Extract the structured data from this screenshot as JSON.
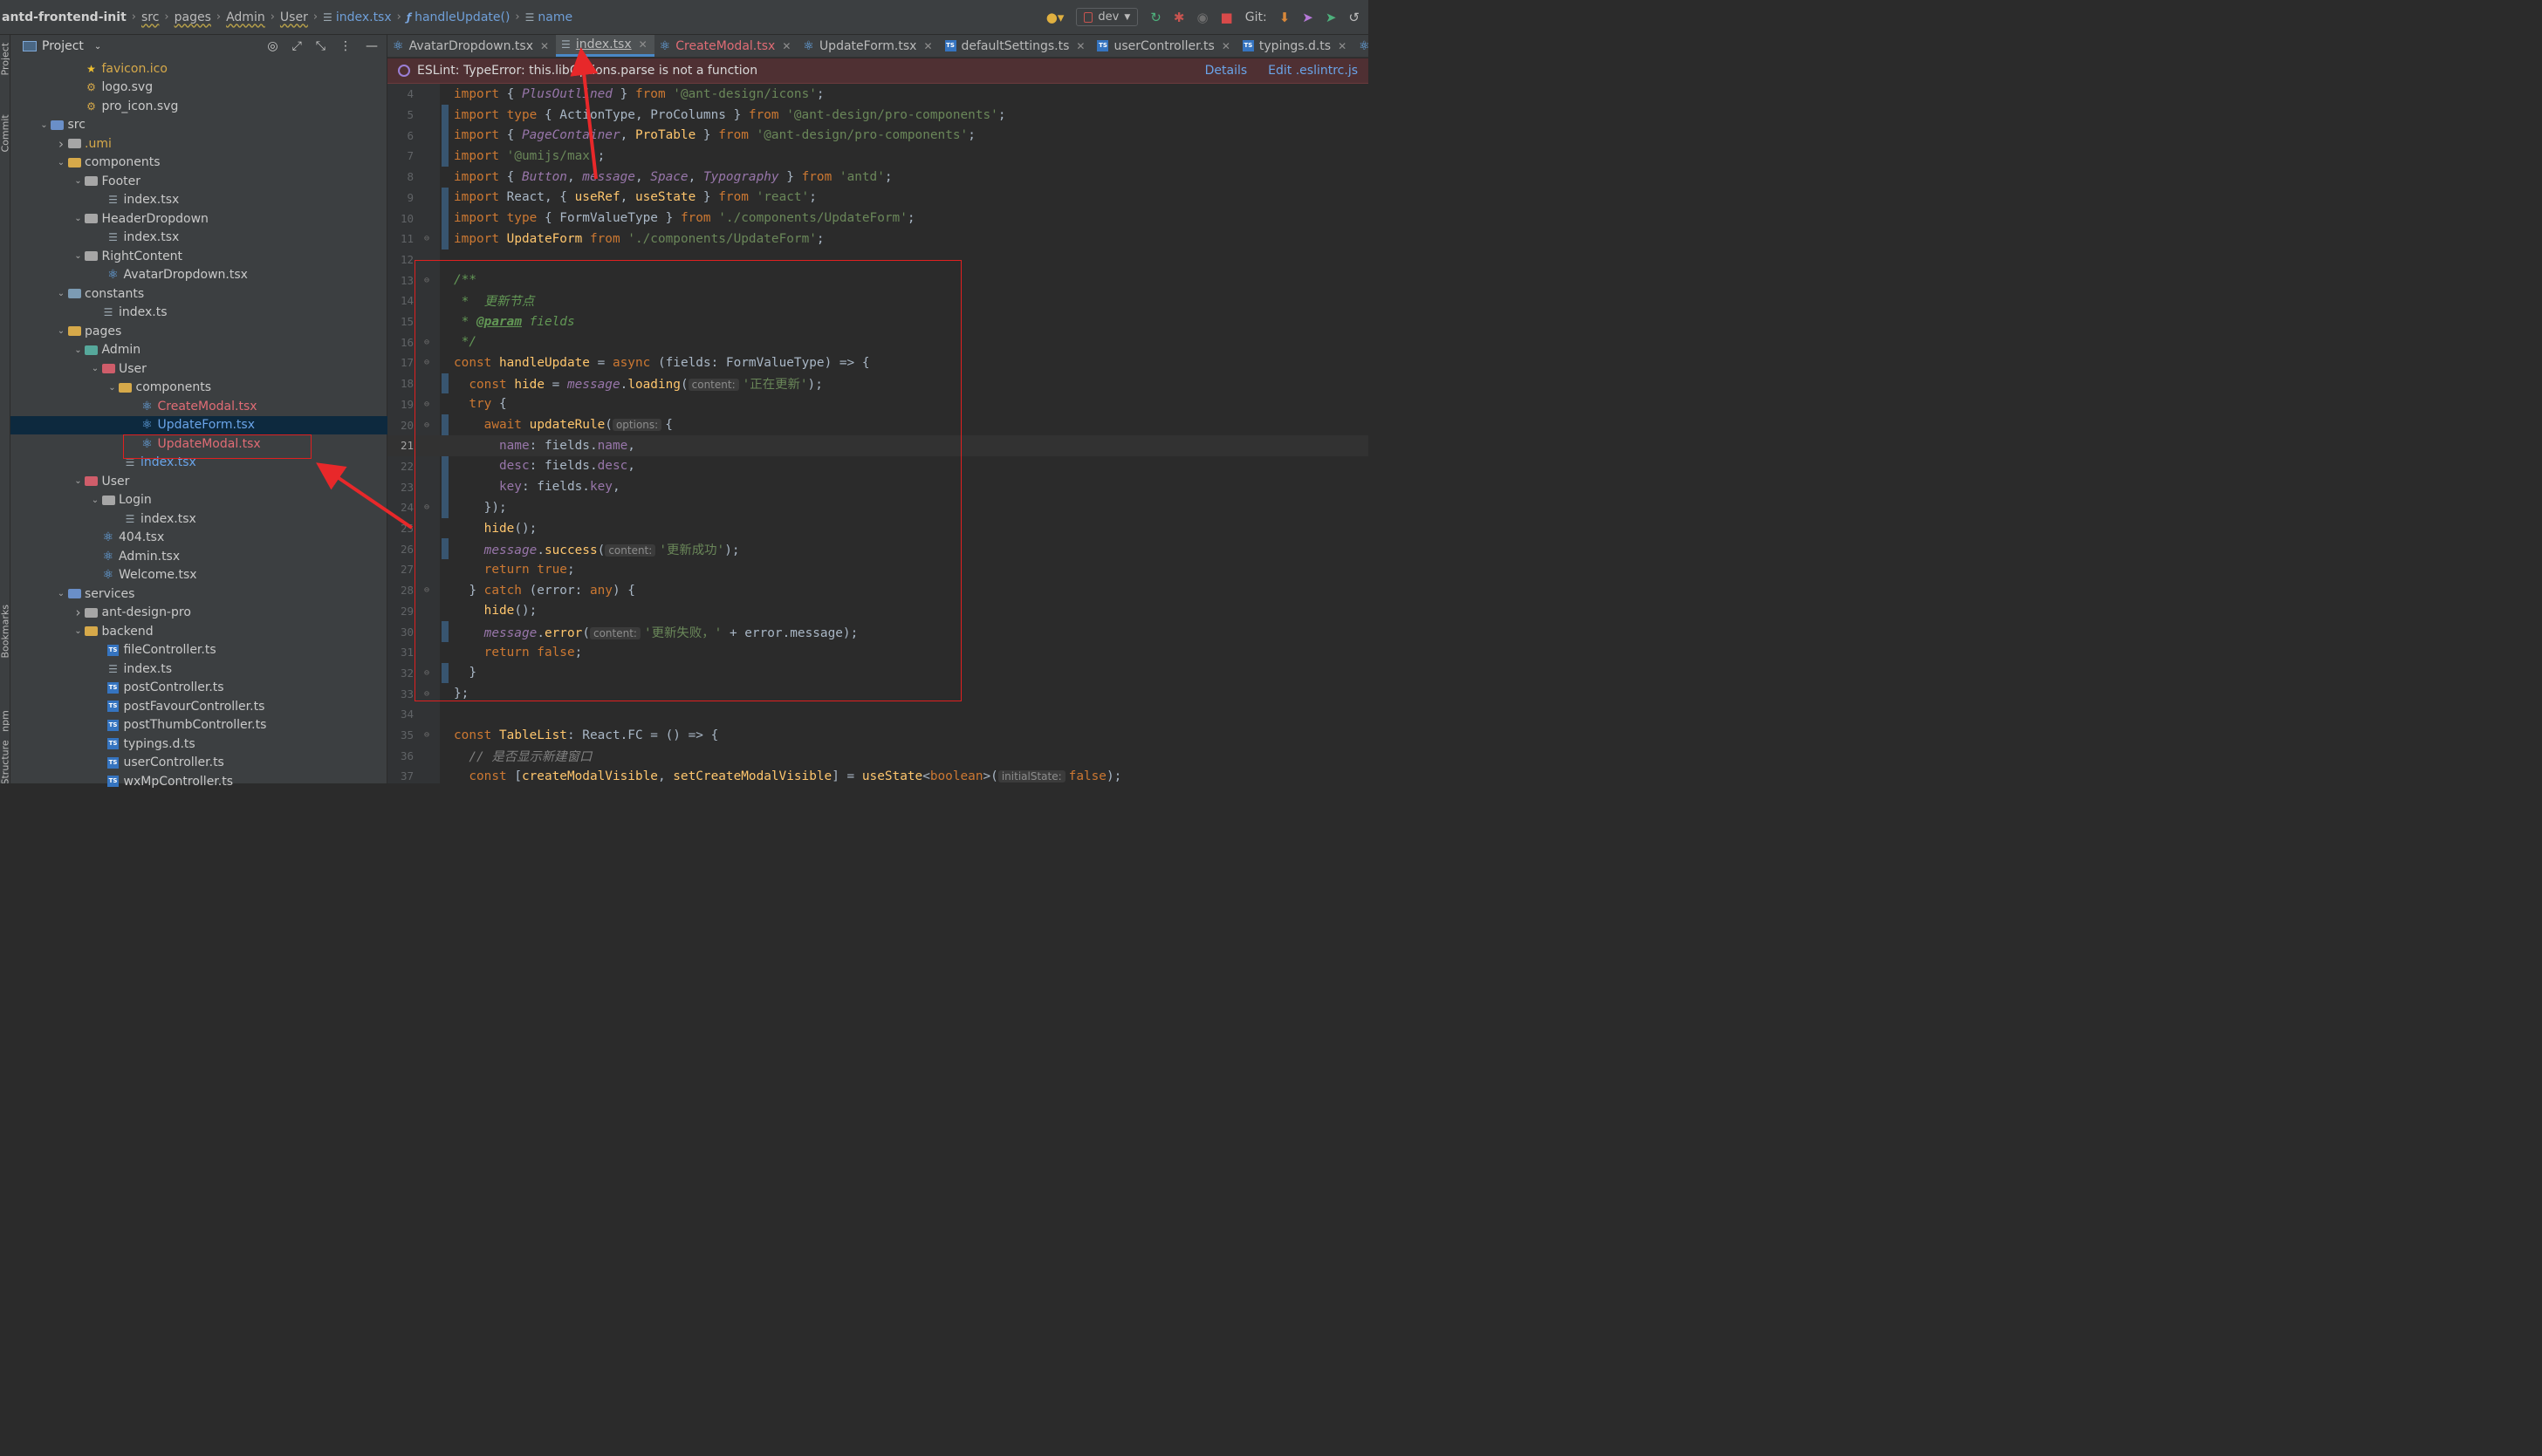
{
  "breadcrumb": [
    "antd-frontend-init",
    "src",
    "pages",
    "Admin",
    "User",
    "index.tsx",
    "handleUpdate()",
    "name"
  ],
  "toolbar": {
    "branch": "dev",
    "git_label": "Git:"
  },
  "project_panel": {
    "title": "Project"
  },
  "tree": [
    {
      "label": "favicon.ico",
      "depth": 3,
      "icon": "star-icon",
      "arrow": "",
      "color": "tan"
    },
    {
      "label": "logo.svg",
      "depth": 3,
      "icon": "svg-icon",
      "arrow": ""
    },
    {
      "label": "pro_icon.svg",
      "depth": 3,
      "icon": "svg-icon",
      "arrow": ""
    },
    {
      "label": "src",
      "depth": 1,
      "icon": "folder-blue",
      "arrow": "down"
    },
    {
      "label": ".umi",
      "depth": 2,
      "icon": "folder",
      "arrow": "right",
      "color": "tan"
    },
    {
      "label": "components",
      "depth": 2,
      "icon": "folder-yel",
      "arrow": "down"
    },
    {
      "label": "Footer",
      "depth": 3,
      "icon": "folder",
      "arrow": "down"
    },
    {
      "label": "index.tsx",
      "depth": 5,
      "icon": "lines",
      "arrow": ""
    },
    {
      "label": "HeaderDropdown",
      "depth": 3,
      "icon": "folder",
      "arrow": "down"
    },
    {
      "label": "index.tsx",
      "depth": 5,
      "icon": "lines",
      "arrow": ""
    },
    {
      "label": "RightContent",
      "depth": 3,
      "icon": "folder",
      "arrow": "down"
    },
    {
      "label": "AvatarDropdown.tsx",
      "depth": 5,
      "icon": "react",
      "arrow": ""
    },
    {
      "label": "constants",
      "depth": 2,
      "icon": "folder-gray",
      "arrow": "down"
    },
    {
      "label": "index.ts",
      "depth": 4,
      "icon": "lines",
      "arrow": ""
    },
    {
      "label": "pages",
      "depth": 2,
      "icon": "folder-yel",
      "arrow": "down"
    },
    {
      "label": "Admin",
      "depth": 3,
      "icon": "folder-teal",
      "arrow": "down"
    },
    {
      "label": "User",
      "depth": 4,
      "icon": "folder-red",
      "arrow": "down"
    },
    {
      "label": "components",
      "depth": 5,
      "icon": "folder-yel",
      "arrow": "down"
    },
    {
      "label": "CreateModal.tsx",
      "depth": 7,
      "icon": "react",
      "arrow": "",
      "color": "red"
    },
    {
      "label": "UpdateForm.tsx",
      "depth": 7,
      "icon": "react",
      "arrow": "",
      "color": "blue",
      "selected": true
    },
    {
      "label": "UpdateModal.tsx",
      "depth": 7,
      "icon": "react",
      "arrow": "",
      "color": "red"
    },
    {
      "label": "index.tsx",
      "depth": 6,
      "icon": "lines",
      "arrow": "",
      "color": "blue"
    },
    {
      "label": "User",
      "depth": 3,
      "icon": "folder-red",
      "arrow": "down"
    },
    {
      "label": "Login",
      "depth": 4,
      "icon": "folder",
      "arrow": "down"
    },
    {
      "label": "index.tsx",
      "depth": 6,
      "icon": "lines",
      "arrow": ""
    },
    {
      "label": "404.tsx",
      "depth": 4,
      "icon": "react",
      "arrow": ""
    },
    {
      "label": "Admin.tsx",
      "depth": 4,
      "icon": "react",
      "arrow": ""
    },
    {
      "label": "Welcome.tsx",
      "depth": 4,
      "icon": "react",
      "arrow": ""
    },
    {
      "label": "services",
      "depth": 2,
      "icon": "folder-blue",
      "arrow": "down"
    },
    {
      "label": "ant-design-pro",
      "depth": 3,
      "icon": "folder",
      "arrow": "right"
    },
    {
      "label": "backend",
      "depth": 3,
      "icon": "folder-yel",
      "arrow": "down"
    },
    {
      "label": "fileController.ts",
      "depth": 5,
      "icon": "ts",
      "arrow": ""
    },
    {
      "label": "index.ts",
      "depth": 5,
      "icon": "lines",
      "arrow": ""
    },
    {
      "label": "postController.ts",
      "depth": 5,
      "icon": "ts",
      "arrow": ""
    },
    {
      "label": "postFavourController.ts",
      "depth": 5,
      "icon": "ts",
      "arrow": ""
    },
    {
      "label": "postThumbController.ts",
      "depth": 5,
      "icon": "ts",
      "arrow": ""
    },
    {
      "label": "typings.d.ts",
      "depth": 5,
      "icon": "ts",
      "arrow": ""
    },
    {
      "label": "userController.ts",
      "depth": 5,
      "icon": "ts",
      "arrow": ""
    },
    {
      "label": "wxMpController.ts",
      "depth": 5,
      "icon": "ts",
      "arrow": ""
    }
  ],
  "tabs": [
    {
      "label": "AvatarDropdown.tsx",
      "icon": "react",
      "active": false
    },
    {
      "label": "index.tsx",
      "icon": "lines",
      "active": true
    },
    {
      "label": "CreateModal.tsx",
      "icon": "react",
      "active": false,
      "color": "red"
    },
    {
      "label": "UpdateForm.tsx",
      "icon": "react",
      "active": false
    },
    {
      "label": "defaultSettings.ts",
      "icon": "ts",
      "active": false
    },
    {
      "label": "userController.ts",
      "icon": "ts",
      "active": false
    },
    {
      "label": "typings.d.ts",
      "icon": "ts",
      "active": false
    },
    {
      "label": "UpdateMo",
      "icon": "react",
      "active": false,
      "color": "red"
    }
  ],
  "banner": {
    "message": "ESLint: TypeError: this.libOptions.parse is not a function",
    "details": "Details",
    "edit": "Edit .eslintrc.js"
  },
  "code_lines": [
    {
      "n": "4",
      "html": "<span class='kw'>import</span> { <span class='ital'>PlusOutlined</span> } <span class='kw'>from</span> <span class='str'>'@ant-design/icons'</span>;"
    },
    {
      "n": "5",
      "html": "<span class='kw'>import type</span> { ActionType, ProColumns } <span class='kw'>from</span> <span class='str'>'@ant-design/pro-components'</span>;"
    },
    {
      "n": "6",
      "html": "<span class='kw'>import</span> { <span class='ital'>PageContainer</span>, <span class='fnm'>ProTable</span> } <span class='kw'>from</span> <span class='str'>'@ant-design/pro-components'</span>;"
    },
    {
      "n": "7",
      "html": "<span class='kw'>import</span> <span class='str'>'@umijs/max'</span>;"
    },
    {
      "n": "8",
      "html": "<span class='kw'>import</span> { <span class='ital'>Button</span>, <span class='ital'>message</span>, <span class='ital'>Space</span>, <span class='ital'>Typography</span> } <span class='kw'>from</span> <span class='str'>'antd'</span>;"
    },
    {
      "n": "9",
      "html": "<span class='kw'>import</span> React, { <span class='fnm'>useRef</span>, <span class='fnm'>useState</span> } <span class='kw'>from</span> <span class='str'>'react'</span>;"
    },
    {
      "n": "10",
      "html": "<span class='kw'>import type</span> { FormValueType } <span class='kw'>from</span> <span class='str'>'./components/UpdateForm'</span>;"
    },
    {
      "n": "11",
      "html": "<span class='kw'>import</span> <span class='fnm'>UpdateForm</span> <span class='kw'>from</span> <span class='str'>'./components/UpdateForm'</span>;"
    },
    {
      "n": "12",
      "html": ""
    },
    {
      "n": "13",
      "html": "<span class='doc'>/**</span>"
    },
    {
      "n": "14",
      "html": "<span class='doc'> *  更新节点</span>"
    },
    {
      "n": "15",
      "html": "<span class='doc'> * </span><span class='doctag'>@param</span><span class='doc'> fields</span>"
    },
    {
      "n": "16",
      "html": "<span class='doc'> */</span>"
    },
    {
      "n": "17",
      "html": "<span class='kw'>const</span> <span class='fnm'>handleUpdate</span> = <span class='kw'>async</span> (fields: FormValueType) => {"
    },
    {
      "n": "18",
      "html": "  <span class='kw'>const</span> <span class='fnm'>hide</span> = <span class='ital'>message</span>.<span class='fnm'>loading</span>(<span class='hint'>content:</span><span class='str'>'正在更新'</span>);"
    },
    {
      "n": "19",
      "html": "  <span class='kw'>try</span> {"
    },
    {
      "n": "20",
      "html": "    <span class='kw'>await</span> <span class='fnm'>updateRule</span>(<span class='hint'>options:</span>{"
    },
    {
      "n": "21",
      "html": "      <span class='prop'>name</span>: fields.<span class='prop'>name</span>,",
      "current": true
    },
    {
      "n": "22",
      "html": "      <span class='prop'>desc</span>: fields.<span class='prop'>desc</span>,"
    },
    {
      "n": "23",
      "html": "      <span class='prop'>key</span>: fields.<span class='prop'>key</span>,"
    },
    {
      "n": "24",
      "html": "    });"
    },
    {
      "n": "25",
      "html": "    <span class='fnm'>hide</span>();"
    },
    {
      "n": "26",
      "html": "    <span class='ital'>message</span>.<span class='fnm'>success</span>(<span class='hint'>content:</span><span class='str'>'更新成功'</span>);"
    },
    {
      "n": "27",
      "html": "    <span class='kw'>return true</span>;"
    },
    {
      "n": "28",
      "html": "  } <span class='kw'>catch</span> (error: <span class='kw'>any</span>) {"
    },
    {
      "n": "29",
      "html": "    <span class='fnm'>hide</span>();"
    },
    {
      "n": "30",
      "html": "    <span class='ital'>message</span>.<span class='fnm'>error</span>(<span class='hint'>content:</span><span class='str'>'更新失败，'</span> + error.message);"
    },
    {
      "n": "31",
      "html": "    <span class='kw'>return false</span>;"
    },
    {
      "n": "32",
      "html": "  }"
    },
    {
      "n": "33",
      "html": "};"
    },
    {
      "n": "34",
      "html": ""
    },
    {
      "n": "35",
      "html": "<span class='kw'>const</span> <span class='fnm'>TableList</span>: React.FC = () => {"
    },
    {
      "n": "36",
      "html": "  <span class='cmt'>// 是否显示新建窗口</span>"
    },
    {
      "n": "37",
      "html": "  <span class='kw'>const</span> [<span class='fnm'>createModalVisible</span>, <span class='fnm'>setCreateModalVisible</span>] = <span class='fnm'>useState</span>&lt;<span class='kw'>boolean</span>&gt;(<span class='hint'>initialState:</span><span class='kw'>false</span>);"
    }
  ],
  "left_strip": [
    "Project",
    "Commit",
    "Bookmarks",
    "npm",
    "Structure"
  ]
}
